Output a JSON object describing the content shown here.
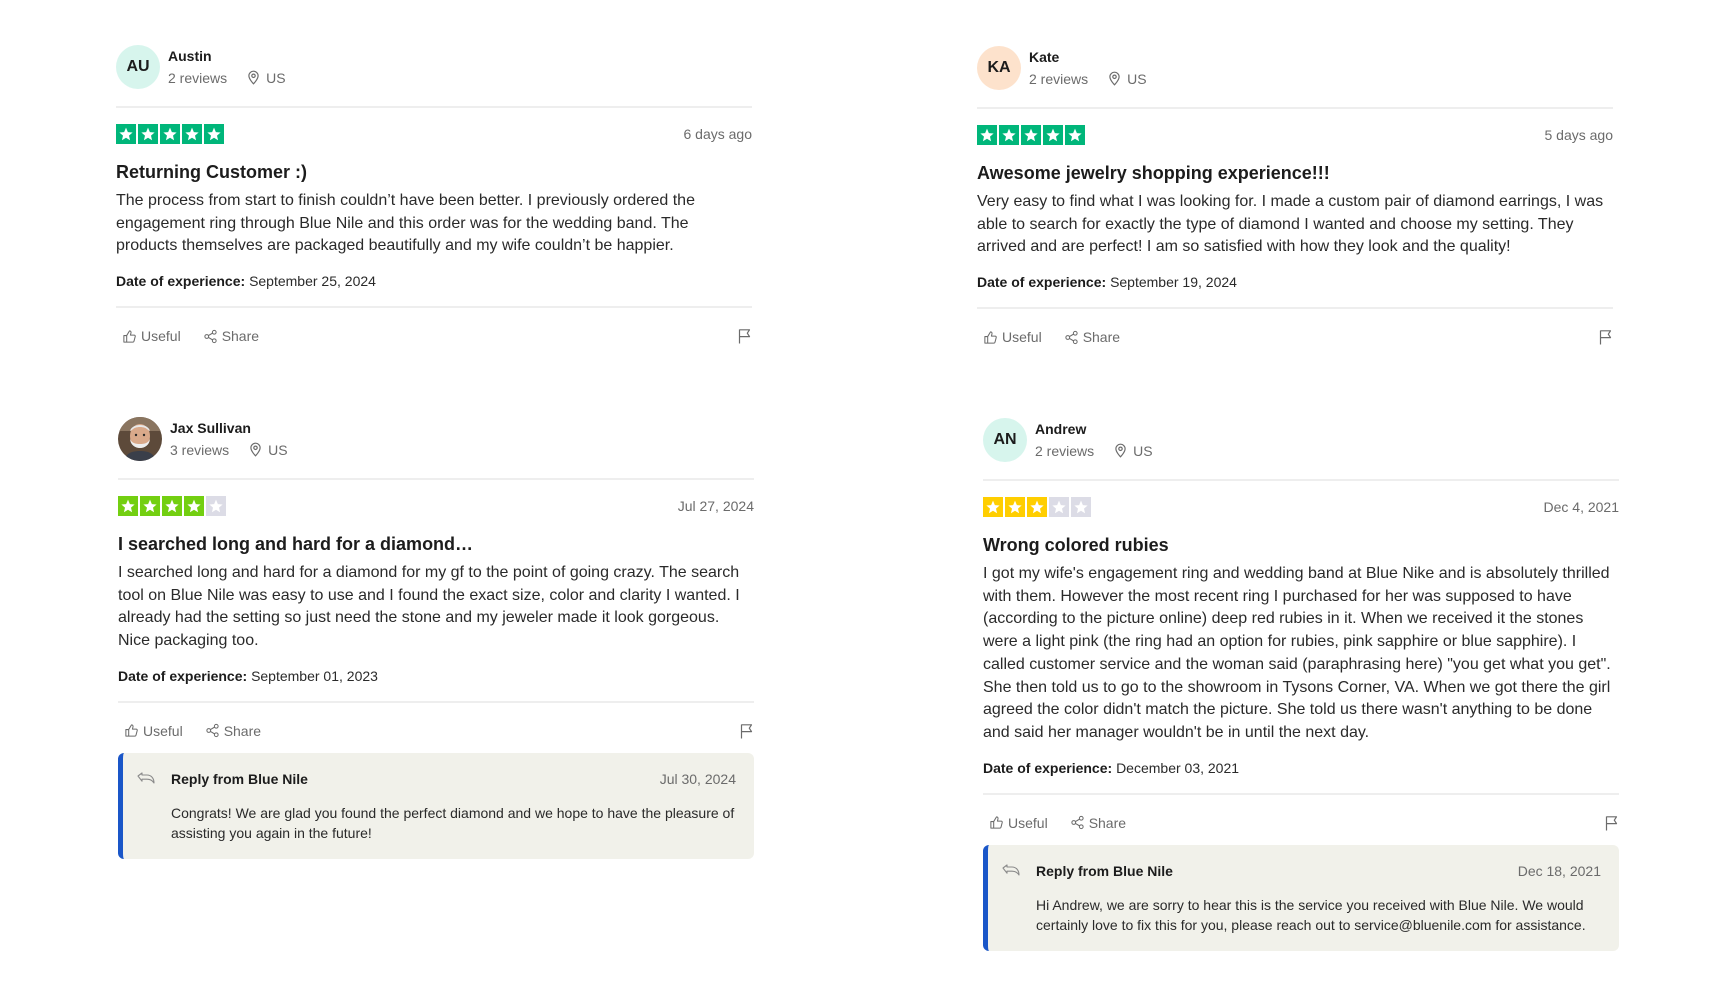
{
  "colors": {
    "star_green": "#00b67a",
    "star_four": "#73cf11",
    "star_three": "#ffce00",
    "star_empty": "#dcdce6",
    "reply_accent": "#1a56c8",
    "reply_bg": "#f1f1ea"
  },
  "actions": {
    "useful_label": "Useful",
    "share_label": "Share"
  },
  "icons": [
    "location-pin-icon",
    "star-icon",
    "thumbs-up-icon",
    "share-icon",
    "flag-icon",
    "reply-arrow-icon"
  ],
  "reviews": [
    {
      "initials": "AU",
      "avatar_color": "#d7f5ed",
      "name": "Austin",
      "review_count": "2 reviews",
      "location": "US",
      "rating": 5,
      "date": "6 days ago",
      "title": "Returning Customer :)",
      "body": "The process from start to finish couldn’t have been better. I previously ordered the engagement ring through Blue Nile and this order was for the wedding band. The products themselves are packaged beautifully and my wife couldn’t be happier.",
      "experience_label": "Date of experience:",
      "experience_date": "September 25, 2024"
    },
    {
      "initials": "KA",
      "avatar_color": "#fde2cc",
      "name": "Kate",
      "review_count": "2 reviews",
      "location": "US",
      "rating": 5,
      "date": "5 days ago",
      "title": "Awesome jewelry shopping experience!!!",
      "body": "Very easy to find what I was looking for. I made a custom pair of diamond earrings, I was able to search for exactly the type of diamond I wanted and choose my setting. They arrived and are perfect! I am so satisfied with how they look and the quality!",
      "experience_label": "Date of experience:",
      "experience_date": "September 19, 2024"
    },
    {
      "name": "Jax Sullivan",
      "review_count": "3 reviews",
      "location": "US",
      "rating": 4,
      "date": "Jul 27, 2024",
      "title": "I searched long and hard for a diamond…",
      "body": "I searched long and hard for a diamond for my gf to the point of going crazy. The search tool on Blue Nile was easy to use and I found the exact size, color and clarity I wanted. I already had the setting so just need the stone and my jeweler made it look gorgeous. Nice packaging too.",
      "experience_label": "Date of experience:",
      "experience_date": "September 01, 2023",
      "reply": {
        "from": "Reply from Blue Nile",
        "date": "Jul 30, 2024",
        "text": "Congrats! We are glad you found the perfect diamond and we hope to have the pleasure of assisting you again in the future!"
      }
    },
    {
      "initials": "AN",
      "avatar_color": "#d7f5ed",
      "name": "Andrew",
      "review_count": "2 reviews",
      "location": "US",
      "rating": 3,
      "date": "Dec 4, 2021",
      "title": "Wrong colored rubies",
      "body": "I got my wife's engagement ring and wedding band at Blue Nike and is absolutely thrilled with them. However the most recent ring I purchased for her was supposed to have (according to the picture online) deep red rubies in it. When we received it the stones were a light pink (the ring had an option for rubies, pink sapphire or blue sapphire). I called customer service and the woman said (paraphrasing here) \"you get what you get\". She then told us to go to the showroom in Tysons Corner, VA. When we got there the girl agreed the color didn't match the picture. She told us there wasn't anything to be done and said her manager wouldn't be in until the next day.",
      "experience_label": "Date of experience:",
      "experience_date": "December 03, 2021",
      "reply": {
        "from": "Reply from Blue Nile",
        "date": "Dec 18, 2021",
        "text": "Hi Andrew, we are sorry to hear this is the service you received with Blue Nile. We would certainly love to fix this for you, please reach out to service@bluenile.com for assistance."
      }
    }
  ]
}
